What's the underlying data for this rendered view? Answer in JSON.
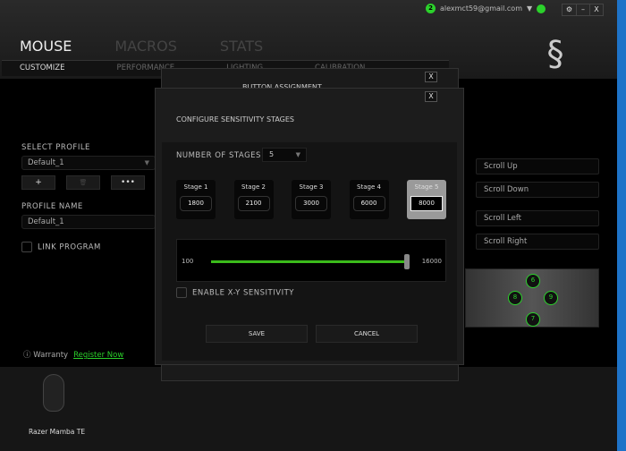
{
  "header": {
    "notification_count": "2",
    "account_email": "alexmct59@gmail.com",
    "window_buttons": [
      "⚙",
      "–",
      "X"
    ],
    "main_tabs": [
      "MOUSE",
      "MACROS",
      "STATS"
    ],
    "sub_tabs": [
      "CUSTOMIZE",
      "PERFORMANCE",
      "LIGHTING",
      "CALIBRATION"
    ]
  },
  "profile": {
    "select_label": "SELECT PROFILE",
    "selected": "Default_1",
    "buttons": [
      "+",
      "🗑",
      "•••"
    ],
    "name_label": "PROFILE NAME",
    "name_value": "Default_1",
    "link_program": "LINK PROGRAM",
    "link_checked": false
  },
  "warranty": {
    "label": "Warranty",
    "link": "Register Now"
  },
  "device": {
    "name": "Razer Mamba TE"
  },
  "assignments": [
    "Scroll Up",
    "Scroll Down",
    "Scroll Left",
    "Scroll Right"
  ],
  "mouse_buttons": [
    "6",
    "8",
    "9",
    "7"
  ],
  "back_dialog": {
    "title": "BUTTON ASSIGNMENT",
    "close": "X"
  },
  "dialog": {
    "title": "CONFIGURE SENSITIVITY STAGES",
    "close": "X",
    "stages_label": "NUMBER OF STAGES",
    "stages_value": "5",
    "stages": [
      {
        "label": "Stage 1",
        "value": "1800"
      },
      {
        "label": "Stage 2",
        "value": "2100"
      },
      {
        "label": "Stage 3",
        "value": "3000"
      },
      {
        "label": "Stage 4",
        "value": "6000"
      },
      {
        "label": "Stage 5",
        "value": "8000"
      }
    ],
    "active_stage": 5,
    "slider_min": "100",
    "slider_max": "16000",
    "slider_value": 16000,
    "xy_label": "ENABLE X-Y SENSITIVITY",
    "xy_checked": false,
    "save": "SAVE",
    "cancel": "CANCEL"
  },
  "colors": {
    "accent": "#2bd12b"
  }
}
